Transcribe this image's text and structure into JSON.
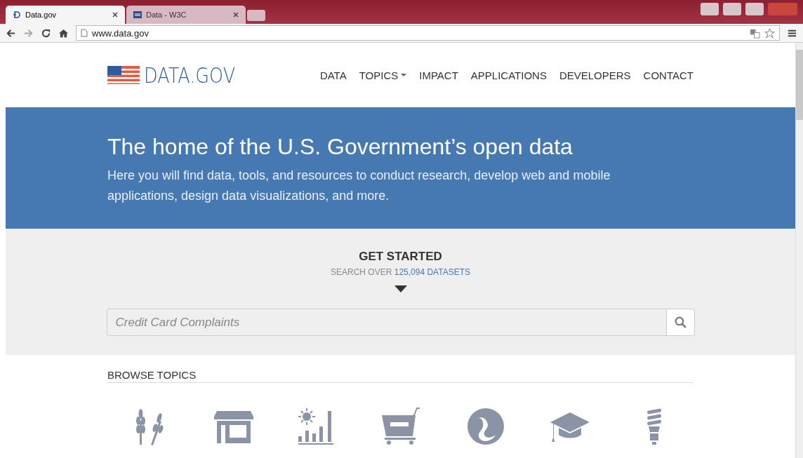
{
  "browser": {
    "tabs": [
      {
        "label": "Data.gov",
        "selected": true
      },
      {
        "label": "Data - W3C",
        "selected": false
      }
    ],
    "address": "www.data.gov"
  },
  "header": {
    "logo": "DATA.GOV",
    "nav": [
      {
        "label": "DATA",
        "has_menu": false
      },
      {
        "label": "TOPICS",
        "has_menu": true
      },
      {
        "label": "IMPACT",
        "has_menu": false
      },
      {
        "label": "APPLICATIONS",
        "has_menu": false
      },
      {
        "label": "DEVELOPERS",
        "has_menu": false
      },
      {
        "label": "CONTACT",
        "has_menu": false
      }
    ]
  },
  "hero": {
    "title": "The home of the U.S. Government’s open data",
    "subtitle": "Here you will find data, tools, and resources to conduct research, develop web and mobile applications, design data visualizations, and more."
  },
  "get_started": {
    "heading": "GET STARTED",
    "prefix": "SEARCH OVER",
    "count_link": "125,094 DATASETS",
    "search": {
      "placeholder": "Credit Card Complaints"
    }
  },
  "browse": {
    "heading": "BROWSE TOPICS"
  }
}
